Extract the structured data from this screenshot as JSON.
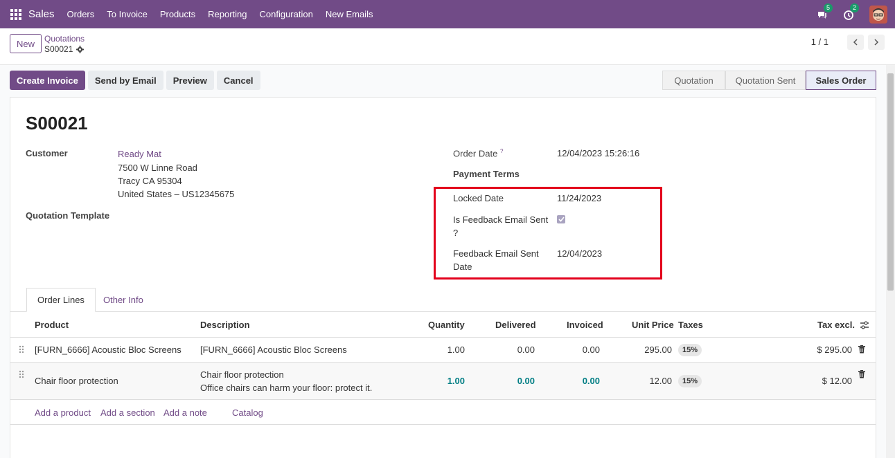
{
  "navbar": {
    "brand": "Sales",
    "items": [
      "Orders",
      "To Invoice",
      "Products",
      "Reporting",
      "Configuration",
      "New Emails"
    ],
    "messages_count": "5",
    "activities_count": "2"
  },
  "control_panel": {
    "new_label": "New",
    "breadcrumb_parent": "Quotations",
    "breadcrumb_current": "S00021",
    "pager": "1 / 1"
  },
  "actions": {
    "create_invoice": "Create Invoice",
    "send_by_email": "Send by Email",
    "preview": "Preview",
    "cancel": "Cancel"
  },
  "status": [
    "Quotation",
    "Quotation Sent",
    "Sales Order"
  ],
  "form": {
    "title": "S00021",
    "customer_label": "Customer",
    "customer_name": "Ready Mat",
    "address_line1": "7500 W Linne Road",
    "address_line2": "Tracy CA 95304",
    "address_line3": "United States – US12345675",
    "quotation_template_label": "Quotation Template",
    "order_date_label": "Order Date",
    "order_date_help": "?",
    "order_date_value": "12/04/2023 15:26:16",
    "payment_terms_label": "Payment Terms",
    "locked_date_label": "Locked Date",
    "locked_date_value": "11/24/2023",
    "feedback_sent_label_1": "Is Feedback Email Sent",
    "feedback_sent_label_2": "?",
    "feedback_sent_checked": true,
    "feedback_date_label_1": "Feedback Email Sent",
    "feedback_date_label_2": "Date",
    "feedback_date_value": "12/04/2023"
  },
  "tabs": [
    "Order Lines",
    "Other Info"
  ],
  "table": {
    "headers": [
      "Product",
      "Description",
      "Quantity",
      "Delivered",
      "Invoiced",
      "Unit Price",
      "Taxes",
      "Tax excl."
    ],
    "rows": [
      {
        "product": "[FURN_6666] Acoustic Bloc Screens",
        "description_1": "[FURN_6666] Acoustic Bloc Screens",
        "description_2": "",
        "quantity": "1.00",
        "delivered": "0.00",
        "invoiced": "0.00",
        "unit_price": "295.00",
        "taxes": "15%",
        "subtotal": "$ 295.00"
      },
      {
        "product": "Chair floor protection",
        "description_1": "Chair floor protection",
        "description_2": "Office chairs can harm your floor: protect it.",
        "quantity": "1.00",
        "delivered": "0.00",
        "invoiced": "0.00",
        "unit_price": "12.00",
        "taxes": "15%",
        "subtotal": "$ 12.00"
      }
    ],
    "add_links": [
      "Add a product",
      "Add a section",
      "Add a note",
      "Catalog"
    ]
  },
  "colors": {
    "brand": "#714b87",
    "highlight_box": "#e3001b",
    "link_teal": "#017e84"
  }
}
